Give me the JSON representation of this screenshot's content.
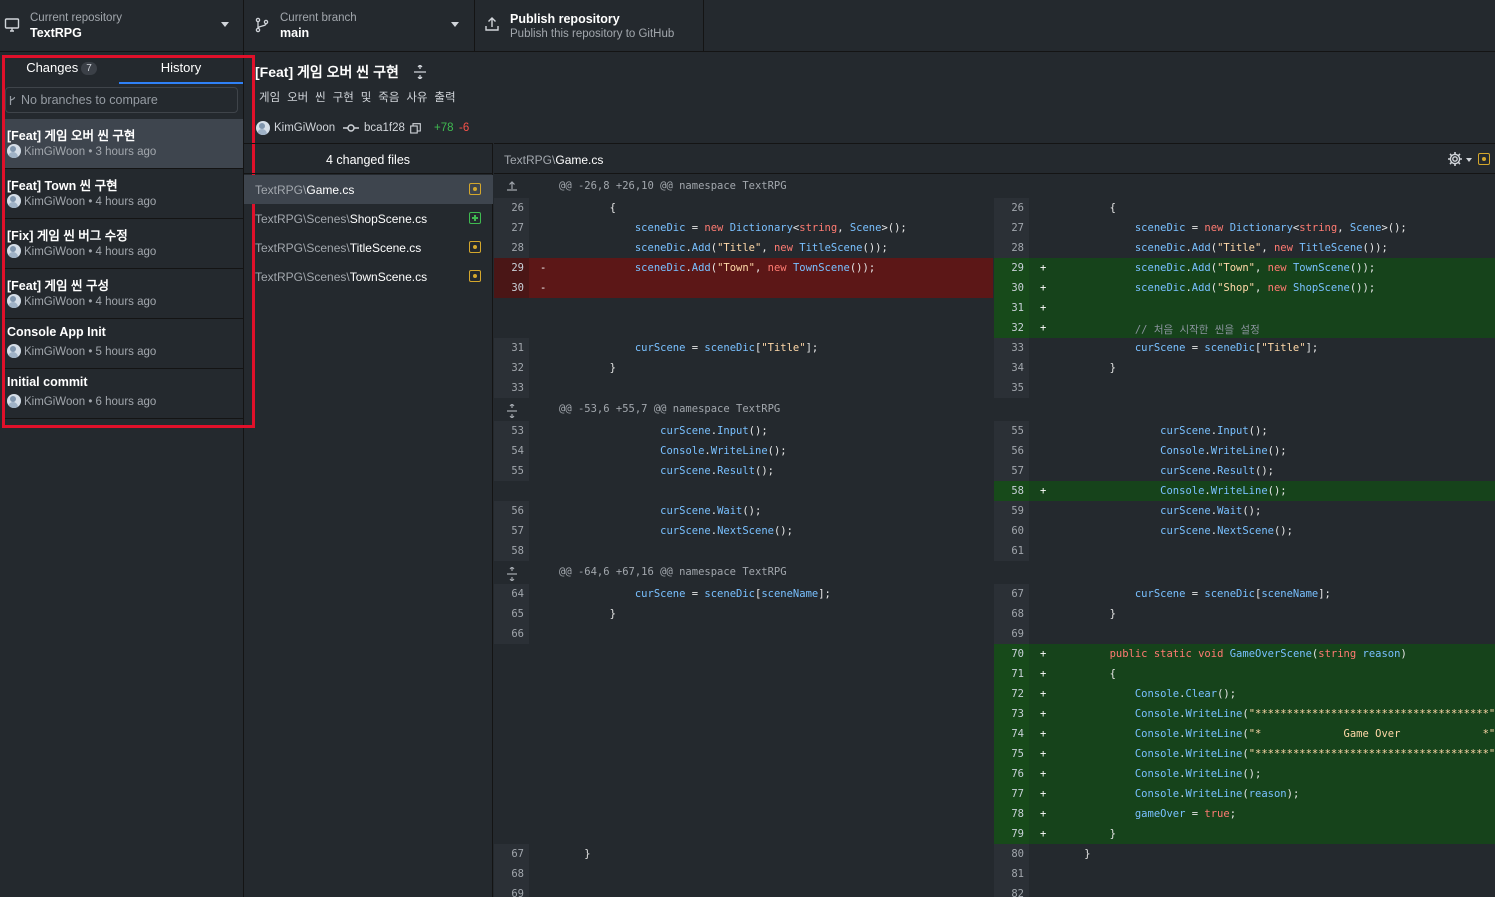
{
  "toolbar": {
    "repo": {
      "sub": "Current repository",
      "name": "TextRPG"
    },
    "branch": {
      "sub": "Current branch",
      "name": "main"
    },
    "publish": {
      "title": "Publish repository",
      "sub": "Publish this repository to GitHub"
    }
  },
  "sidebar": {
    "tabs": {
      "changes": "Changes",
      "changes_count": "7",
      "history": "History"
    },
    "compare_placeholder": "No branches to compare",
    "commits": [
      {
        "title": "[Feat] 게임 오버 씬 구현",
        "meta": "KimGiWoon • 3 hours ago"
      },
      {
        "title": "[Feat] Town 씬 구현",
        "meta": "KimGiWoon • 4 hours ago"
      },
      {
        "title": "[Fix] 게임 씬 버그 수정",
        "meta": "KimGiWoon • 4 hours ago"
      },
      {
        "title": "[Feat] 게임 씬 구성",
        "meta": "KimGiWoon • 4 hours ago"
      },
      {
        "title": "Console App Init",
        "meta": "KimGiWoon • 5 hours ago"
      },
      {
        "title": "Initial commit",
        "meta": "KimGiWoon • 6 hours ago"
      }
    ]
  },
  "commit_detail": {
    "title": "[Feat] 게임 오버 씬 구현",
    "description": "게임 오버 씬 구현 및 죽음 사유 출력",
    "author": "KimGiWoon",
    "sha": "bca1f28",
    "additions": "+78",
    "deletions": "-6",
    "changed_files_label": "4 changed files",
    "files": [
      {
        "dir": "TextRPG\\",
        "name": "Game.cs",
        "status": "modified"
      },
      {
        "dir": "TextRPG\\Scenes\\",
        "name": "ShopScene.cs",
        "status": "added"
      },
      {
        "dir": "TextRPG\\Scenes\\",
        "name": "TitleScene.cs",
        "status": "modified"
      },
      {
        "dir": "TextRPG\\Scenes\\",
        "name": "TownScene.cs",
        "status": "modified"
      }
    ]
  },
  "diff": {
    "path_dir": "TextRPG\\",
    "path_file": "Game.cs",
    "rows": [
      {
        "hunk": "@@ -26,8 +26,10 @@ namespace TextRPG"
      },
      {
        "l": [
          "26",
          "ctx",
          "        {"
        ],
        "r": [
          "26",
          "ctx",
          "        {"
        ]
      },
      {
        "l": [
          "27",
          "ctx",
          "            sceneDic = new Dictionary<string, Scene>();"
        ],
        "r": [
          "27",
          "ctx",
          "            sceneDic = new Dictionary<string, Scene>();"
        ]
      },
      {
        "l": [
          "28",
          "ctx",
          "            sceneDic.Add(\"Title\", new TitleScene());"
        ],
        "r": [
          "28",
          "ctx",
          "            sceneDic.Add(\"Title\", new TitleScene());"
        ]
      },
      {
        "l": [
          "29",
          "del",
          "            sceneDic.Add(\"Town\", new TownScene());"
        ],
        "r": [
          "29",
          "add",
          "            sceneDic.Add(\"Town\", new TownScene());"
        ]
      },
      {
        "l": [
          "30",
          "del",
          ""
        ],
        "r": [
          "30",
          "add",
          "            sceneDic.Add(\"Shop\", new ShopScene());"
        ]
      },
      {
        "l": [
          "",
          "emp",
          ""
        ],
        "r": [
          "31",
          "add",
          ""
        ]
      },
      {
        "l": [
          "",
          "emp",
          ""
        ],
        "r": [
          "32",
          "add",
          "            // 처음 시작한 씬을 설정"
        ]
      },
      {
        "l": [
          "31",
          "ctx",
          "            curScene = sceneDic[\"Title\"];"
        ],
        "r": [
          "33",
          "ctx",
          "            curScene = sceneDic[\"Title\"];"
        ]
      },
      {
        "l": [
          "32",
          "ctx",
          "        }"
        ],
        "r": [
          "34",
          "ctx",
          "        }"
        ]
      },
      {
        "l": [
          "33",
          "ctx",
          ""
        ],
        "r": [
          "35",
          "ctx",
          ""
        ]
      },
      {
        "hunk": "@@ -53,6 +55,7 @@ namespace TextRPG"
      },
      {
        "l": [
          "53",
          "ctx",
          "                curScene.Input();"
        ],
        "r": [
          "55",
          "ctx",
          "                curScene.Input();"
        ]
      },
      {
        "l": [
          "54",
          "ctx",
          "                Console.WriteLine();"
        ],
        "r": [
          "56",
          "ctx",
          "                Console.WriteLine();"
        ]
      },
      {
        "l": [
          "55",
          "ctx",
          "                curScene.Result();"
        ],
        "r": [
          "57",
          "ctx",
          "                curScene.Result();"
        ]
      },
      {
        "l": [
          "",
          "emp",
          ""
        ],
        "r": [
          "58",
          "add",
          "                Console.WriteLine();"
        ]
      },
      {
        "l": [
          "56",
          "ctx",
          "                curScene.Wait();"
        ],
        "r": [
          "59",
          "ctx",
          "                curScene.Wait();"
        ]
      },
      {
        "l": [
          "57",
          "ctx",
          "                curScene.NextScene();"
        ],
        "r": [
          "60",
          "ctx",
          "                curScene.NextScene();"
        ]
      },
      {
        "l": [
          "58",
          "ctx",
          ""
        ],
        "r": [
          "61",
          "ctx",
          ""
        ]
      },
      {
        "hunk": "@@ -64,6 +67,16 @@ namespace TextRPG"
      },
      {
        "l": [
          "64",
          "ctx",
          "            curScene = sceneDic[sceneName];"
        ],
        "r": [
          "67",
          "ctx",
          "            curScene = sceneDic[sceneName];"
        ]
      },
      {
        "l": [
          "65",
          "ctx",
          "        }"
        ],
        "r": [
          "68",
          "ctx",
          "        }"
        ]
      },
      {
        "l": [
          "66",
          "ctx",
          ""
        ],
        "r": [
          "69",
          "ctx",
          ""
        ]
      },
      {
        "l": [
          "",
          "emp",
          ""
        ],
        "r": [
          "70",
          "add",
          "        public static void GameOverScene(string reason)"
        ]
      },
      {
        "l": [
          "",
          "emp",
          ""
        ],
        "r": [
          "71",
          "add",
          "        {"
        ]
      },
      {
        "l": [
          "",
          "emp",
          ""
        ],
        "r": [
          "72",
          "add",
          "            Console.Clear();"
        ]
      },
      {
        "l": [
          "",
          "emp",
          ""
        ],
        "r": [
          "73",
          "add",
          "            Console.WriteLine(\"*************************************\");"
        ]
      },
      {
        "l": [
          "",
          "emp",
          ""
        ],
        "r": [
          "74",
          "add",
          "            Console.WriteLine(\"*             Game Over             *\");"
        ]
      },
      {
        "l": [
          "",
          "emp",
          ""
        ],
        "r": [
          "75",
          "add",
          "            Console.WriteLine(\"*************************************\");"
        ]
      },
      {
        "l": [
          "",
          "emp",
          ""
        ],
        "r": [
          "76",
          "add",
          "            Console.WriteLine();"
        ]
      },
      {
        "l": [
          "",
          "emp",
          ""
        ],
        "r": [
          "77",
          "add",
          "            Console.WriteLine(reason);"
        ]
      },
      {
        "l": [
          "",
          "emp",
          ""
        ],
        "r": [
          "78",
          "add",
          "            gameOver = true;"
        ]
      },
      {
        "l": [
          "",
          "emp",
          ""
        ],
        "r": [
          "79",
          "add",
          "        }"
        ]
      },
      {
        "l": [
          "67",
          "ctx",
          "    }"
        ],
        "r": [
          "80",
          "ctx",
          "    }"
        ]
      },
      {
        "l": [
          "68",
          "ctx",
          ""
        ],
        "r": [
          "81",
          "ctx",
          ""
        ]
      },
      {
        "l": [
          "69",
          "ctx",
          ""
        ],
        "r": [
          "82",
          "ctx",
          ""
        ]
      }
    ]
  },
  "colors": {
    "added": "#3fb950",
    "deleted": "#f85149",
    "accent": "#2f81f7",
    "highlight_box": "#e0102a"
  },
  "icons": [
    "computer-icon",
    "branch-icon",
    "upload-icon",
    "compare-branch-icon",
    "commit-icon",
    "copy-icon",
    "expand-icon",
    "gear-icon",
    "file-modified-icon",
    "file-added-icon"
  ]
}
